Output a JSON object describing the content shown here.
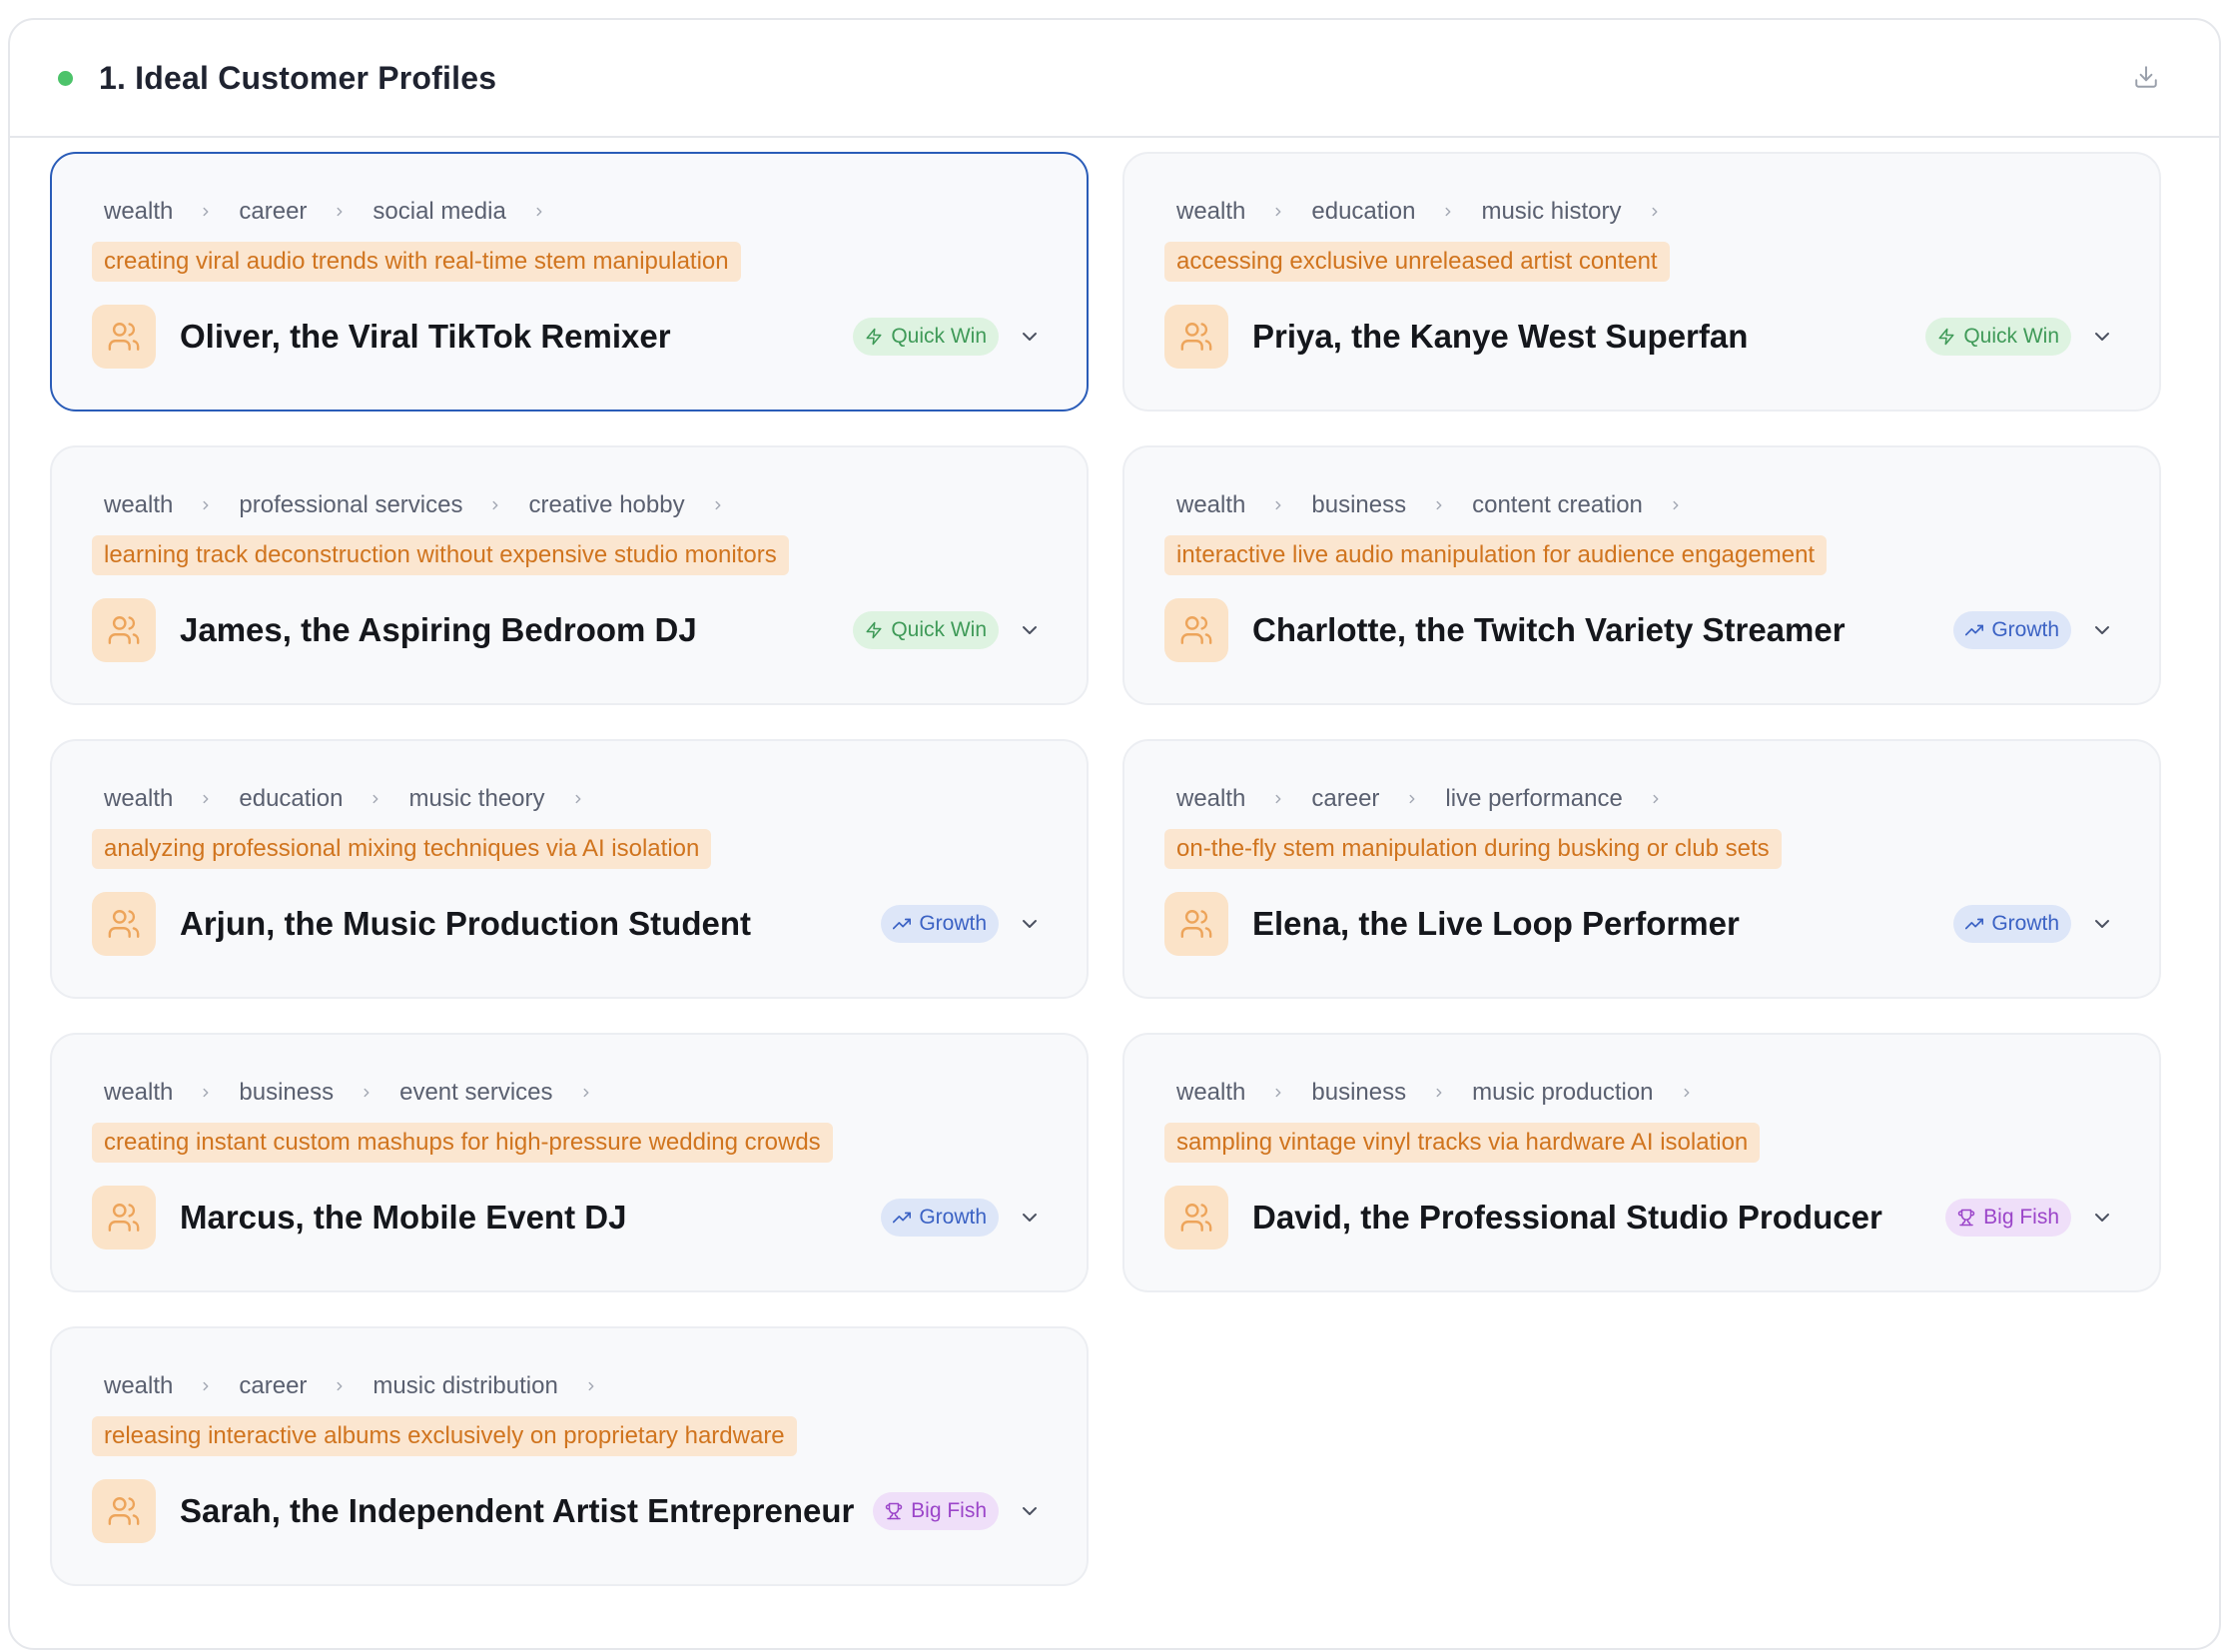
{
  "header": {
    "title": "1. Ideal Customer Profiles",
    "status_color": "#4cc36a"
  },
  "colors": {
    "quick_win": "#3f9a58",
    "growth": "#3b62c4",
    "big_fish": "#9b45c9",
    "use_case_text": "#d0741e",
    "selected_border": "#2a5cb8"
  },
  "profiles": [
    {
      "path": [
        "wealth",
        "career",
        "social media"
      ],
      "use_case": "creating viral audio trends with real-time stem manipulation",
      "name": "Oliver, the Viral TikTok Remixer",
      "badge": "Quick Win",
      "badge_type": "quick",
      "selected": true
    },
    {
      "path": [
        "wealth",
        "education",
        "music history"
      ],
      "use_case": "accessing exclusive unreleased artist content",
      "name": "Priya, the Kanye West Superfan",
      "badge": "Quick Win",
      "badge_type": "quick",
      "selected": false
    },
    {
      "path": [
        "wealth",
        "professional services",
        "creative hobby"
      ],
      "use_case": "learning track deconstruction without expensive studio monitors",
      "name": "James, the Aspiring Bedroom DJ",
      "badge": "Quick Win",
      "badge_type": "quick",
      "selected": false
    },
    {
      "path": [
        "wealth",
        "business",
        "content creation"
      ],
      "use_case": "interactive live audio manipulation for audience engagement",
      "name": "Charlotte, the Twitch Variety Streamer",
      "badge": "Growth",
      "badge_type": "growth",
      "selected": false
    },
    {
      "path": [
        "wealth",
        "education",
        "music theory"
      ],
      "use_case": "analyzing professional mixing techniques via AI isolation",
      "name": "Arjun, the Music Production Student",
      "badge": "Growth",
      "badge_type": "growth",
      "selected": false
    },
    {
      "path": [
        "wealth",
        "career",
        "live performance"
      ],
      "use_case": "on-the-fly stem manipulation during busking or club sets",
      "name": "Elena, the Live Loop Performer",
      "badge": "Growth",
      "badge_type": "growth",
      "selected": false
    },
    {
      "path": [
        "wealth",
        "business",
        "event services"
      ],
      "use_case": "creating instant custom mashups for high-pressure wedding crowds",
      "name": "Marcus, the Mobile Event DJ",
      "badge": "Growth",
      "badge_type": "growth",
      "selected": false
    },
    {
      "path": [
        "wealth",
        "business",
        "music production"
      ],
      "use_case": "sampling vintage vinyl tracks via hardware AI isolation",
      "name": "David, the Professional Studio Producer",
      "badge": "Big Fish",
      "badge_type": "bigfish",
      "selected": false
    },
    {
      "path": [
        "wealth",
        "career",
        "music distribution"
      ],
      "use_case": "releasing interactive albums exclusively on proprietary hardware",
      "name": "Sarah, the Independent Artist Entrepreneur",
      "badge": "Big Fish",
      "badge_type": "bigfish",
      "selected": false
    }
  ]
}
